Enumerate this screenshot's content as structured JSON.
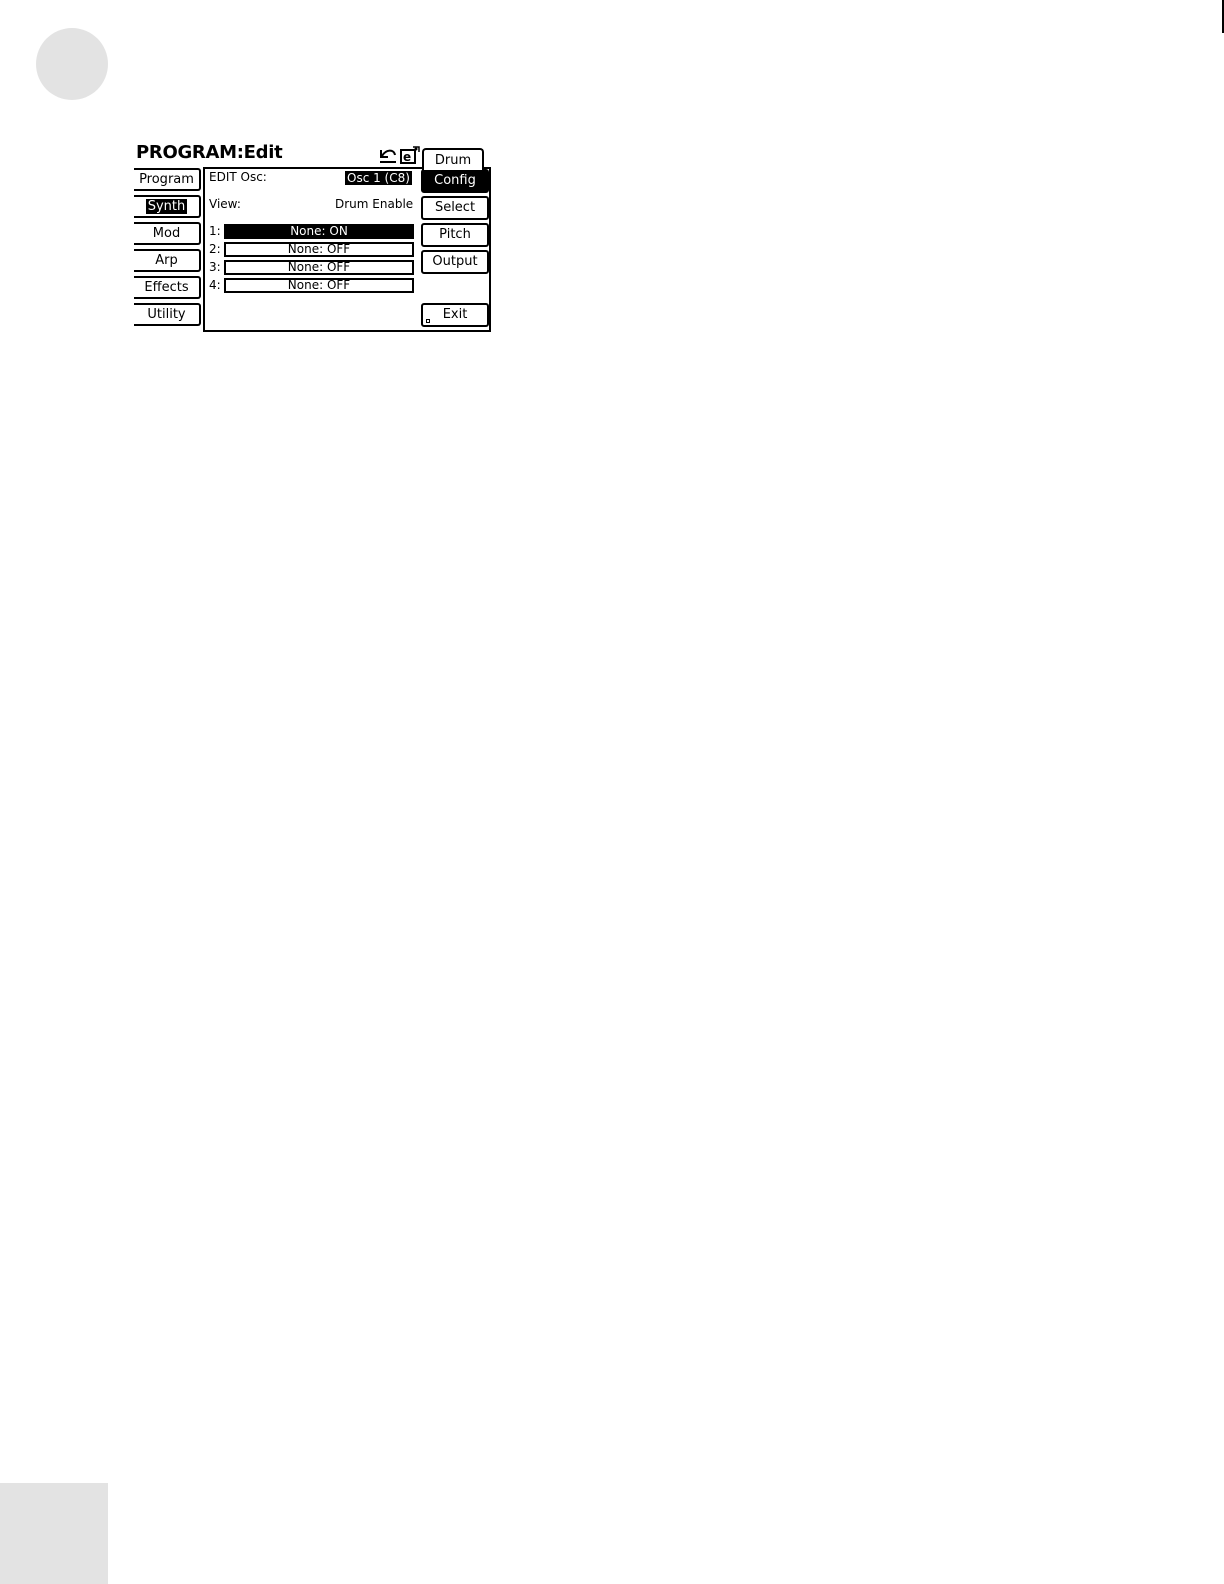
{
  "screen": {
    "title": "PROGRAM:Edit",
    "icons": [
      "undo-icon",
      "edit-icon"
    ],
    "tab": "Drum"
  },
  "left_nav": {
    "items": [
      {
        "label": "Program",
        "selected": false
      },
      {
        "label": "Synth",
        "selected": true
      },
      {
        "label": "Mod",
        "selected": false
      },
      {
        "label": "Arp",
        "selected": false
      },
      {
        "label": "Effects",
        "selected": false
      },
      {
        "label": "Utility",
        "selected": false
      }
    ]
  },
  "edit": {
    "label": "EDIT Osc:",
    "value": "Osc 1 (C8)",
    "view_label": "View:",
    "view_value": "Drum Enable"
  },
  "rows": [
    {
      "num": "1:",
      "value": "None: ON",
      "on": true
    },
    {
      "num": "2:",
      "value": "None: OFF",
      "on": false
    },
    {
      "num": "3:",
      "value": "None: OFF",
      "on": false
    },
    {
      "num": "4:",
      "value": "None: OFF",
      "on": false
    }
  ],
  "right_buttons": {
    "config": "Config",
    "select": "Select",
    "pitch": "Pitch",
    "output": "Output",
    "exit": "Exit"
  }
}
